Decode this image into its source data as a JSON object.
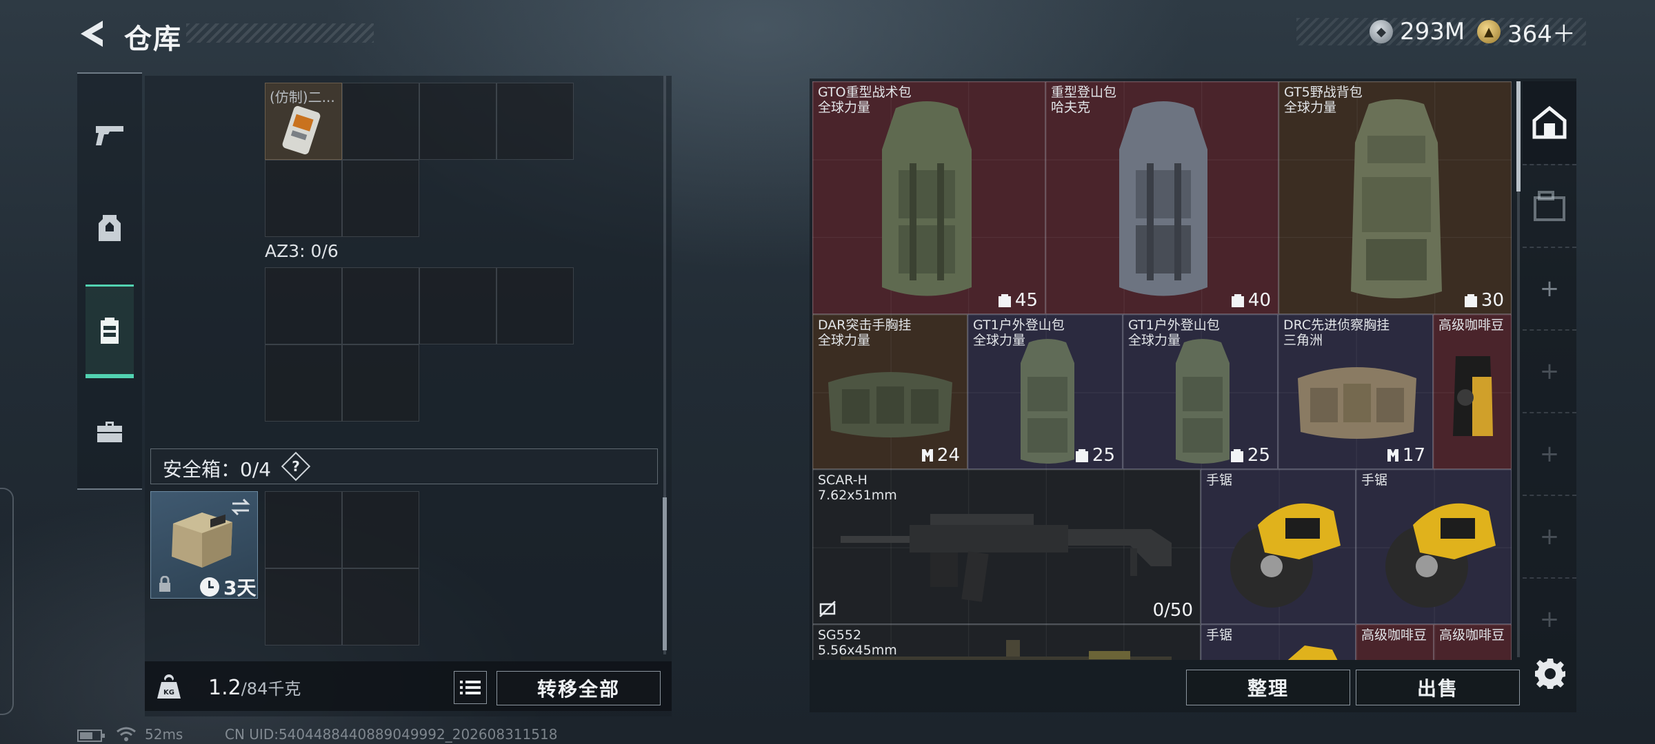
{
  "header": {
    "title": "仓库",
    "currency_silver": "293M",
    "currency_gold": "364＋"
  },
  "left_panel": {
    "partial_item_label": "(仿制)二...",
    "az3_label": "AZ3: 0/6",
    "safebox_label": "安全箱：0/4",
    "help": "?",
    "safebox_timer": "3天"
  },
  "weight": {
    "current": "1.2",
    "max": "/84千克"
  },
  "buttons": {
    "transfer_all": "转移全部",
    "sort": "整理",
    "sell": "出售"
  },
  "stash_items": [
    {
      "name": "GTO重型战术包",
      "sub": "全球力量",
      "capacity": "45"
    },
    {
      "name": "重型登山包",
      "sub": "哈夫克",
      "capacity": "40"
    },
    {
      "name": "GT5野战背包",
      "sub": "全球力量",
      "capacity": "30"
    },
    {
      "name": "DAR突击手胸挂",
      "sub": "全球力量",
      "capacity": "24"
    },
    {
      "name": "GT1户外登山包",
      "sub": "全球力量",
      "capacity": "25"
    },
    {
      "name": "GT1户外登山包",
      "sub": "全球力量",
      "capacity": "25"
    },
    {
      "name": "DRC先进侦察胸挂",
      "sub": "三角洲",
      "capacity": "17"
    },
    {
      "name": "高级咖啡豆",
      "sub": ""
    },
    {
      "name": "SCAR-H",
      "sub": "7.62x51mm",
      "ammo": "0/50"
    },
    {
      "name": "手锯",
      "sub": ""
    },
    {
      "name": "手锯",
      "sub": ""
    },
    {
      "name": "SG552",
      "sub": "5.56x45mm"
    },
    {
      "name": "手锯",
      "sub": ""
    },
    {
      "name": "高级咖啡豆",
      "sub": ""
    },
    {
      "name": "高级咖啡豆",
      "sub": ""
    }
  ],
  "status_bar": {
    "ping": "52ms",
    "uid": "CN UID:5404488440889049992_202608311518"
  },
  "colors": {
    "accent": "#52d2b1",
    "red_rarity": "#4a242b",
    "purple_rarity": "#2b2a3f"
  },
  "icons": [
    "back-arrow-icon",
    "silver-coin-icon",
    "gold-coin-icon",
    "pistol-icon",
    "helmet-icon",
    "backpack-icon",
    "briefcase-icon",
    "lock-icon",
    "swap-icon",
    "clock-icon",
    "kg-icon",
    "list-icon",
    "house-icon",
    "stash-icon",
    "plus-icon",
    "gear-icon",
    "wifi-icon",
    "battery-icon"
  ]
}
